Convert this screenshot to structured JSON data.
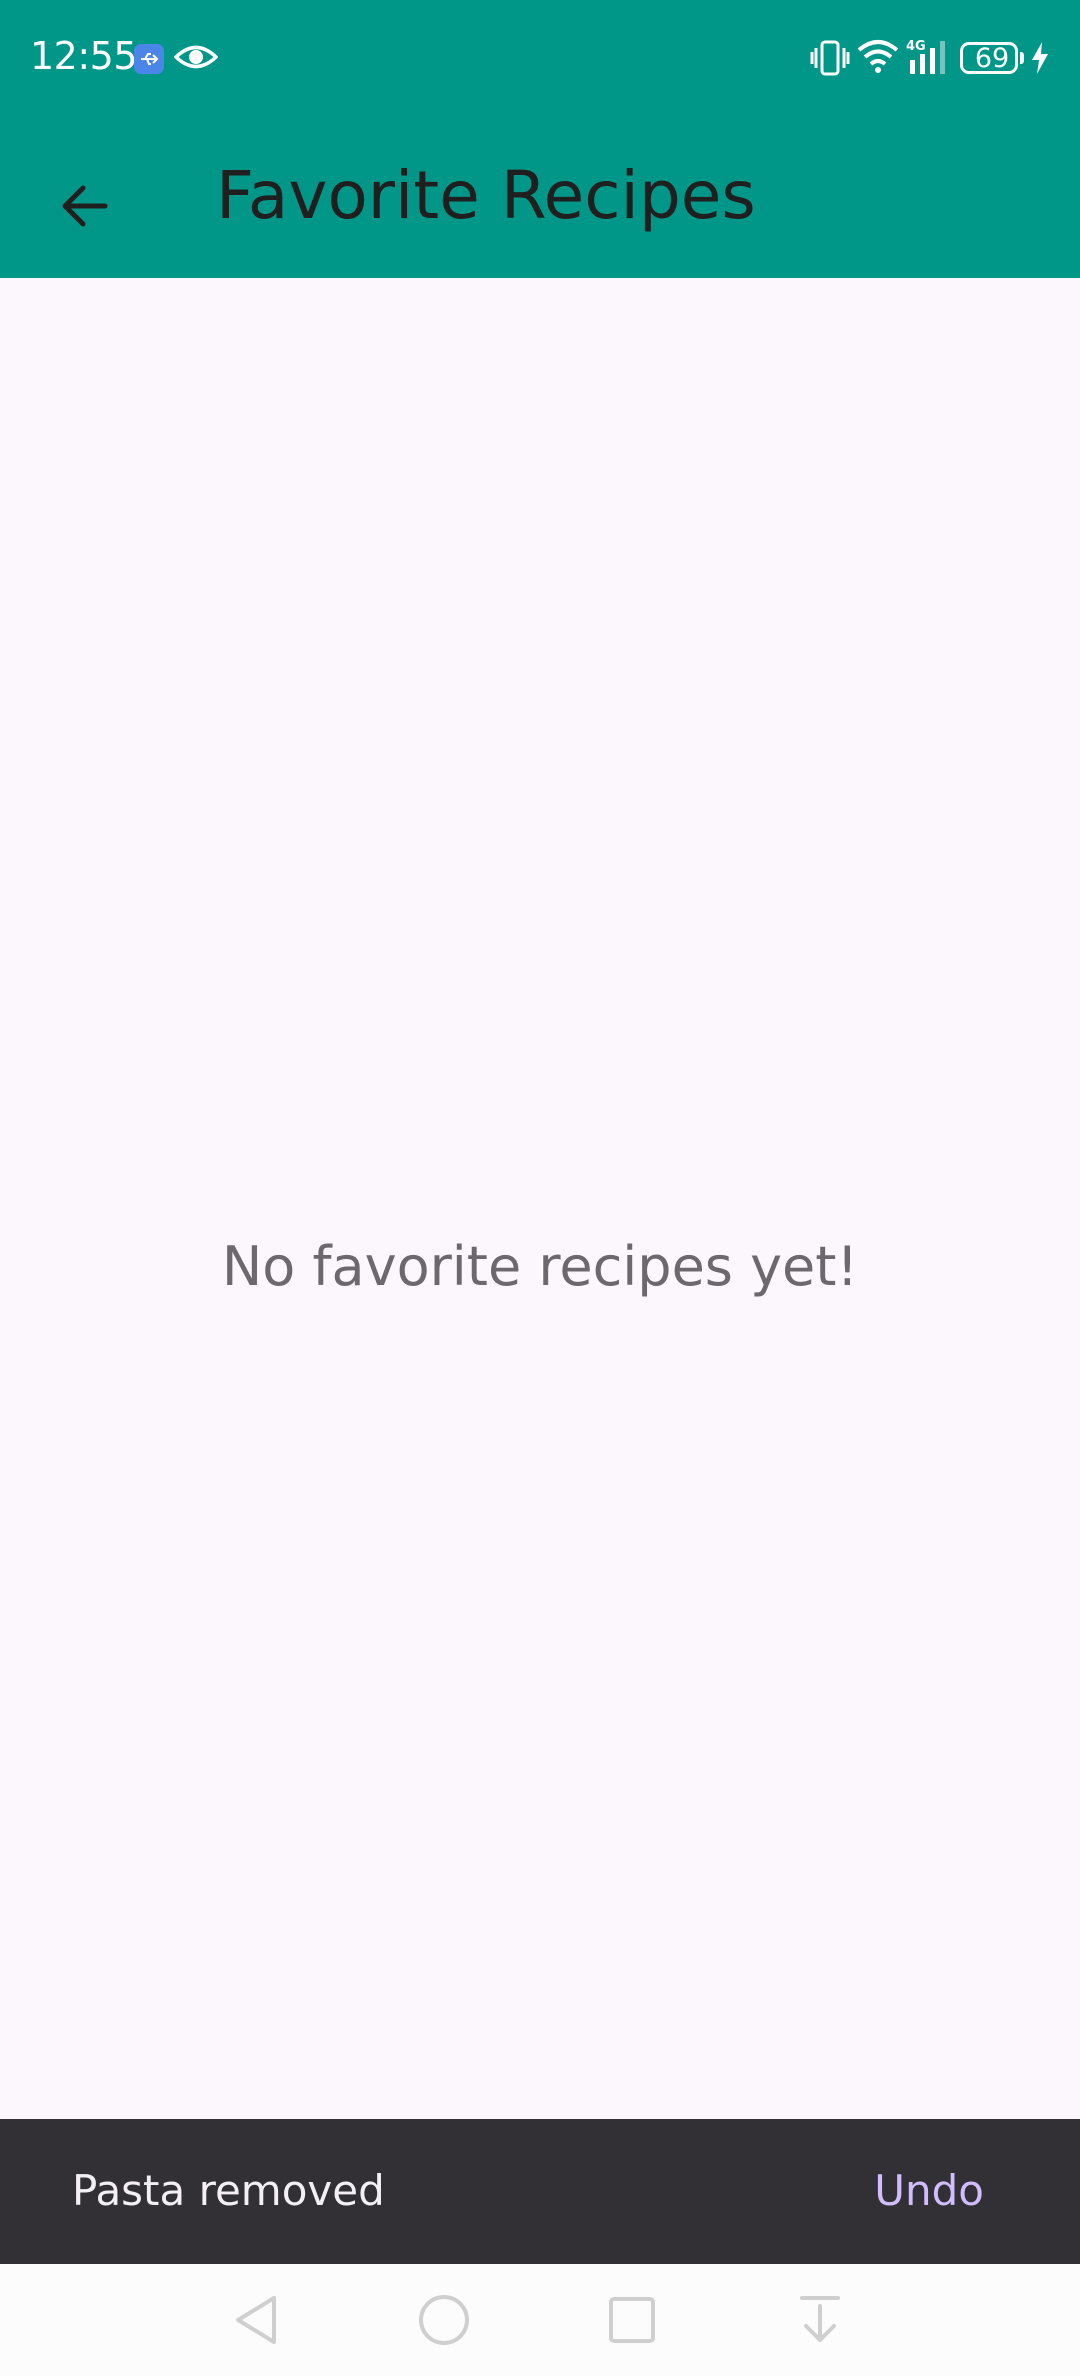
{
  "status_bar": {
    "time": "12:55",
    "battery": "69",
    "icons": [
      "usb-icon",
      "eye-icon",
      "vibrate-icon",
      "wifi-icon",
      "signal-4g-icon",
      "battery-icon",
      "charging-icon"
    ]
  },
  "app_bar": {
    "title": "Favorite Recipes",
    "back_icon": "arrow-left-icon"
  },
  "main": {
    "empty_message": "No favorite recipes yet!"
  },
  "snackbar": {
    "message": "Pasta removed",
    "action": "Undo"
  },
  "nav_bar": {
    "buttons": [
      "back",
      "home",
      "recents",
      "notification-pull-down"
    ]
  },
  "colors": {
    "primary": "#009688",
    "background": "#fcf7fd",
    "snackbar": "#322f35",
    "snackbar_action": "#d0bcff"
  }
}
